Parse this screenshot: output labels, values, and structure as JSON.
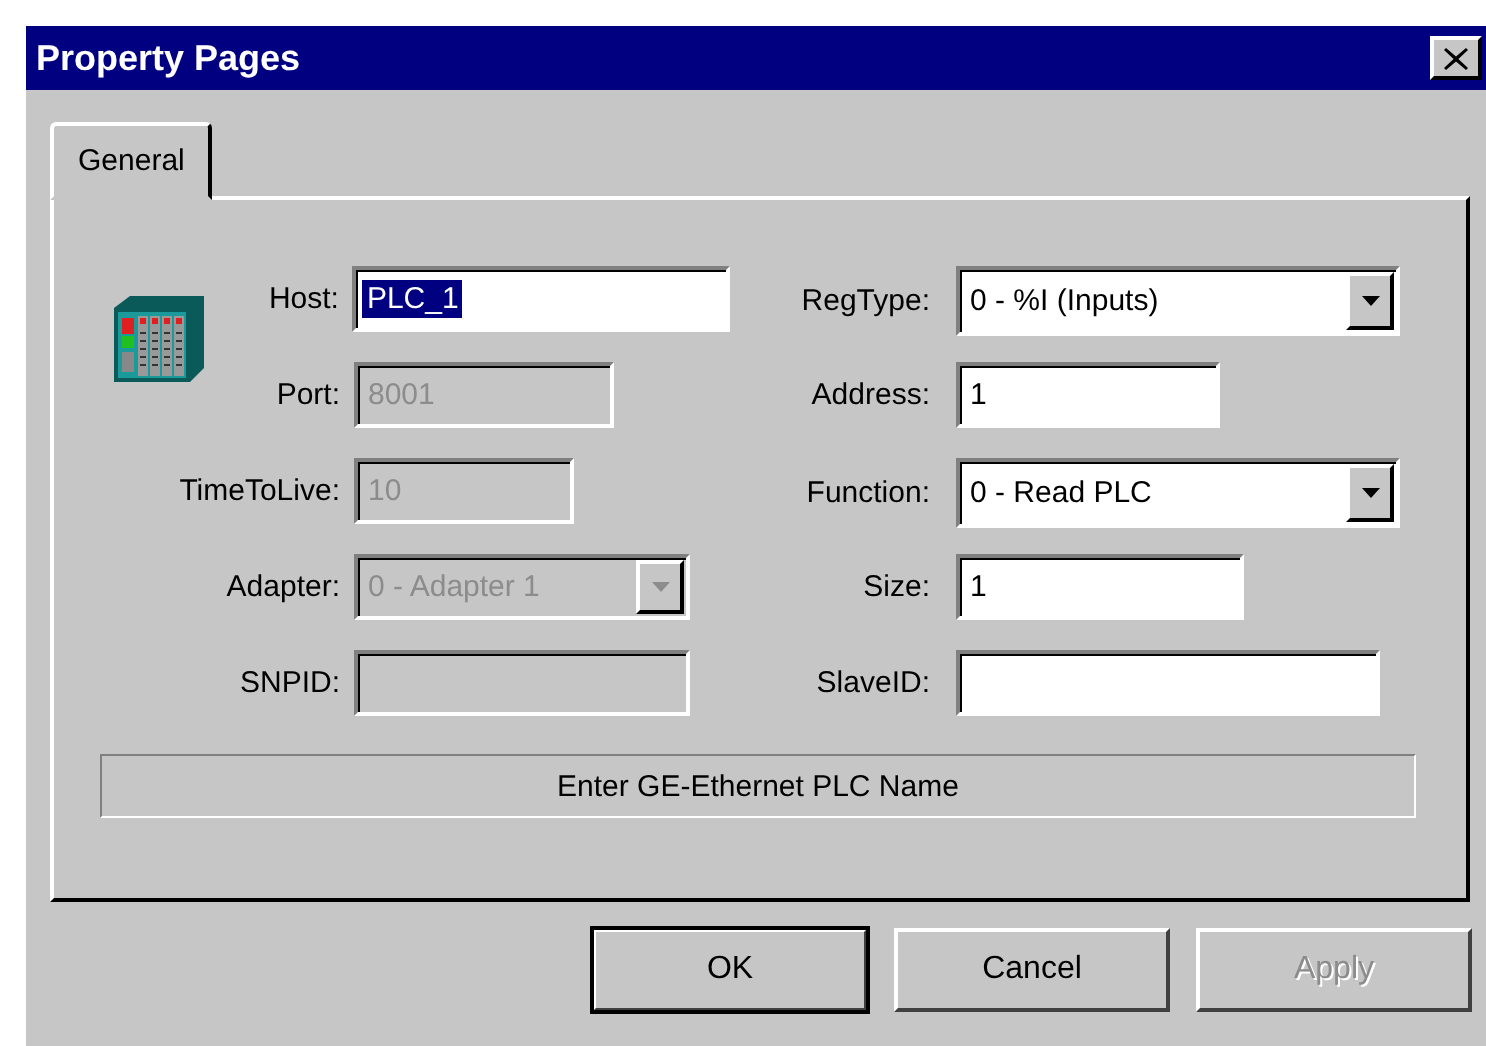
{
  "window": {
    "title": "Property Pages"
  },
  "tabs": [
    {
      "label": "General",
      "selected": true
    }
  ],
  "fields_left": [
    {
      "label": "Host:",
      "kind": "text",
      "value": "PLC_1",
      "disabled": false,
      "value_selected": true
    },
    {
      "label": "Port:",
      "kind": "text",
      "value": "8001",
      "disabled": true
    },
    {
      "label": "TimeToLive:",
      "kind": "text",
      "value": "10",
      "disabled": true
    },
    {
      "label": "Adapter:",
      "kind": "dropdown",
      "value": "0 - Adapter 1",
      "disabled": true
    },
    {
      "label": "SNPID:",
      "kind": "text",
      "disabled": true
    }
  ],
  "fields_right": [
    {
      "label": "RegType:",
      "kind": "dropdown",
      "value": "0 - %I (Inputs)",
      "disabled": false
    },
    {
      "label": "Address:",
      "kind": "text",
      "value": "1",
      "disabled": false
    },
    {
      "label": "Function:",
      "kind": "dropdown",
      "value": "0 - Read PLC",
      "disabled": false
    },
    {
      "label": "Size:",
      "kind": "text",
      "value": "1",
      "disabled": false
    },
    {
      "label": "SlaveID:",
      "kind": "text",
      "disabled": false
    }
  ],
  "status_message": "Enter GE-Ethernet PLC Name",
  "buttons": [
    {
      "label": "OK",
      "default": true,
      "disabled": false
    },
    {
      "label": "Cancel",
      "default": false,
      "disabled": false
    },
    {
      "label": "Apply",
      "default": false,
      "disabled": true
    }
  ]
}
